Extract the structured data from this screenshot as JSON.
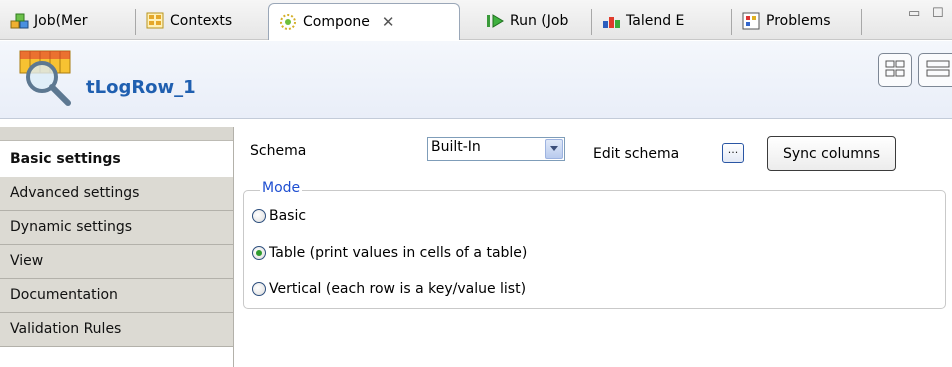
{
  "tabs": [
    {
      "label": "Job(Mer",
      "icon": "job-icon",
      "active": false
    },
    {
      "label": "Contexts",
      "icon": "contexts-icon",
      "active": false
    },
    {
      "label": "Compone",
      "icon": "component-icon",
      "active": true,
      "close_icon": "close-icon"
    },
    {
      "label": "Run (Job",
      "icon": "run-icon",
      "active": false
    },
    {
      "label": "Talend E",
      "icon": "talend-exchange-icon",
      "active": false
    },
    {
      "label": "Problems",
      "icon": "problems-icon",
      "active": false
    }
  ],
  "header": {
    "component_name": "tLogRow_1",
    "component_icon": "tlogrow-icon"
  },
  "nav": {
    "items": [
      {
        "label": "Basic settings",
        "active": true
      },
      {
        "label": "Advanced settings",
        "active": false
      },
      {
        "label": "Dynamic settings",
        "active": false
      },
      {
        "label": "View",
        "active": false
      },
      {
        "label": "Documentation",
        "active": false
      },
      {
        "label": "Validation Rules",
        "active": false
      }
    ]
  },
  "basic": {
    "schema_label": "Schema",
    "schema_value": "Built-In",
    "edit_schema_label": "Edit schema",
    "edit_schema_button": "...",
    "sync_button": "Sync columns",
    "mode": {
      "legend": "Mode",
      "options": [
        {
          "label": "Basic",
          "checked": false
        },
        {
          "label": "Table (print values in cells of a table)",
          "checked": true
        },
        {
          "label": "Vertical (each row is a key/value list)",
          "checked": false
        }
      ]
    }
  },
  "colors": {
    "accent": "#1f5fb0",
    "legend": "#1f4fd1",
    "nav_bg": "#dcdad3",
    "header_bg": "#e9eef8"
  }
}
